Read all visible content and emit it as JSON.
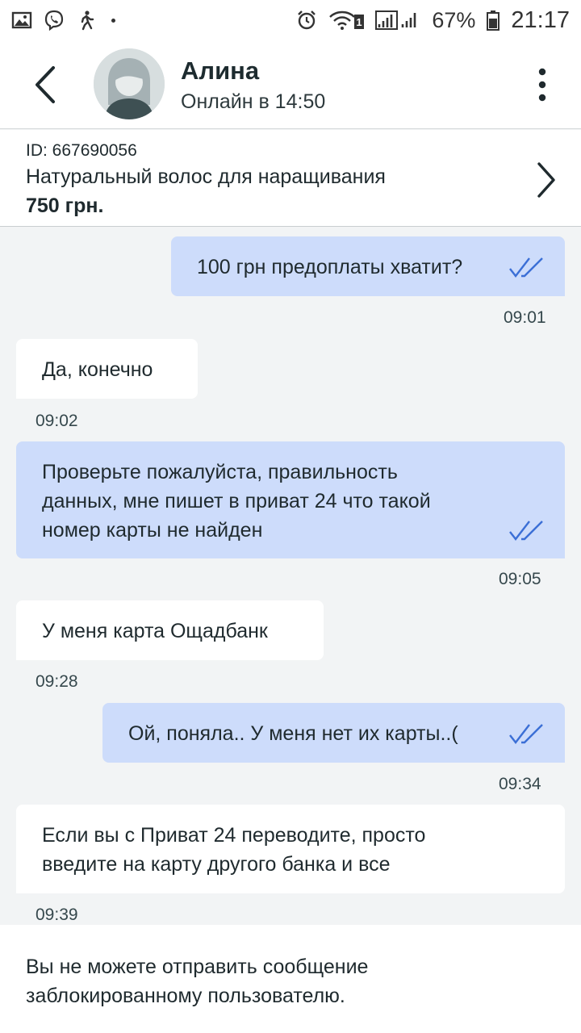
{
  "status_bar": {
    "battery": "67%",
    "time": "21:17",
    "sim_badge": "1",
    "icons": [
      "gallery-icon",
      "viber-icon",
      "walking-icon",
      "alarm-icon",
      "wifi-icon",
      "signal-icon",
      "battery-icon"
    ]
  },
  "header": {
    "name": "Алина",
    "status": "Онлайн в 14:50"
  },
  "product": {
    "id": "ID: 667690056",
    "title": "Натуральный волос для наращивания",
    "price": "750 грн."
  },
  "messages": [
    {
      "direction": "out",
      "text": "100 грн предоплаты хватит?",
      "time": "09:01",
      "read": true
    },
    {
      "direction": "in",
      "text": "Да, конечно",
      "time": "09:02"
    },
    {
      "direction": "out",
      "lines": [
        "Проверьте пожалуйста, правильность",
        "данных, мне пишет в приват 24 что такой",
        "номер карты не найден"
      ],
      "time": "09:05",
      "read": true
    },
    {
      "direction": "in",
      "text": "У меня карта Ощадбанк",
      "time": "09:28"
    },
    {
      "direction": "out",
      "text": "Ой, поняла.. У меня нет их карты..(",
      "time": "09:34",
      "read": true
    },
    {
      "direction": "in",
      "lines": [
        "Если вы с Приват 24 переводите, просто",
        "введите на карту другого банка и все"
      ],
      "time": "09:39"
    }
  ],
  "footer": {
    "lines": [
      "Вы не можете отправить сообщение",
      "заблокированному пользователю."
    ]
  },
  "colors": {
    "outgoing_bubble": "#cddcfb",
    "incoming_bubble": "#ffffff",
    "chat_background": "#f2f4f5",
    "read_checks": "#3b6fd6"
  }
}
